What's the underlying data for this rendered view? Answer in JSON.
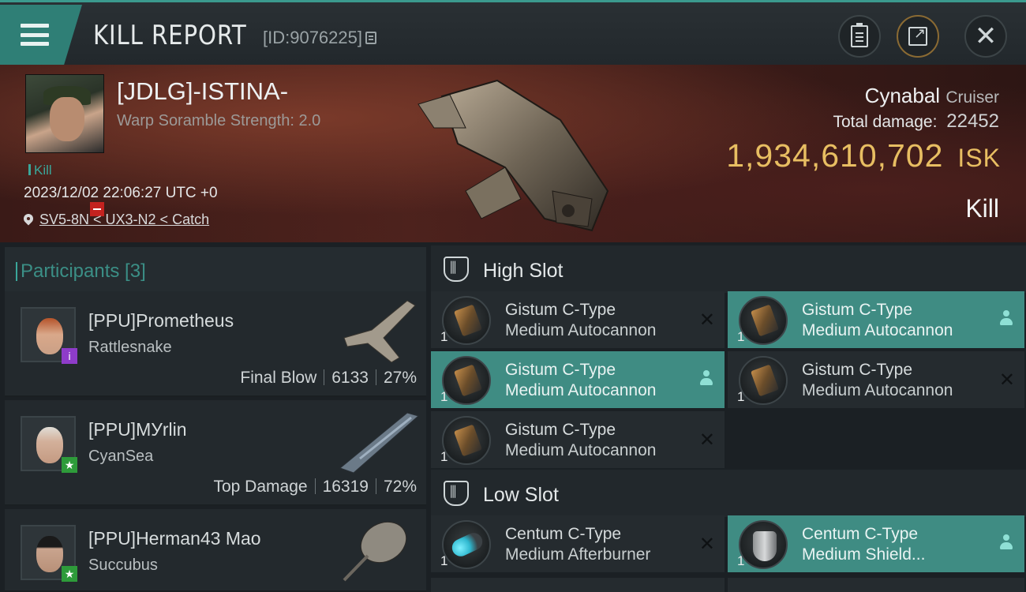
{
  "header": {
    "title": "KILL REPORT",
    "report_id": "[ID:9076225]"
  },
  "victim": {
    "pilot": "[JDLG]-ISTINA-",
    "subtitle": "Warp Soramble Strength: 2.0",
    "tag": "Kill",
    "timestamp": "2023/12/02 22:06:27 UTC +0",
    "location": "SV5-8N < UX3-N2 < Catch",
    "ship": "Cynabal",
    "ship_class": "Cruiser",
    "total_damage_label": "Total damage:",
    "total_damage": "22452",
    "isk_value": "1,934,610,702",
    "isk_unit": "ISK",
    "result": "Kill"
  },
  "participants": {
    "label": "Participants [3]",
    "items": [
      {
        "name": "[PPU]Prometheus",
        "ship": "Rattlesnake",
        "stat_label": "Final Blow",
        "damage": "6133",
        "percent": "27%",
        "badge": "i",
        "badge_color": "#8e3cc9"
      },
      {
        "name": "[PPU]MУrlin",
        "ship": "CyanSea",
        "stat_label": "Top Damage",
        "damage": "16319",
        "percent": "72%",
        "badge": "★",
        "badge_color": "#2e9b3a"
      },
      {
        "name": "[PPU]Herman43 Mao",
        "ship": "Succubus",
        "stat_label": "",
        "damage": "",
        "percent": "",
        "badge": "★",
        "badge_color": "#2e9b3a"
      }
    ]
  },
  "modules": {
    "high_slot_label": "High Slot",
    "low_slot_label": "Low Slot",
    "high": [
      {
        "qty": "1",
        "line1": "Gistum C-Type",
        "line2": "Medium Autocannon",
        "state": "destroyed"
      },
      {
        "qty": "1",
        "line1": "Gistum C-Type",
        "line2": "Medium Autocannon",
        "state": "dropped"
      },
      {
        "qty": "1",
        "line1": "Gistum C-Type",
        "line2": "Medium Autocannon",
        "state": "dropped"
      },
      {
        "qty": "1",
        "line1": "Gistum C-Type",
        "line2": "Medium Autocannon",
        "state": "destroyed"
      },
      {
        "qty": "1",
        "line1": "Gistum C-Type",
        "line2": "Medium Autocannon",
        "state": "destroyed"
      }
    ],
    "low": [
      {
        "qty": "1",
        "line1": "Centum C-Type",
        "line2": "Medium Afterburner",
        "state": "destroyed"
      },
      {
        "qty": "1",
        "line1": "Centum C-Type",
        "line2": "Medium Shield...",
        "state": "dropped"
      }
    ]
  },
  "icons": {
    "menu": "hamburger-icon",
    "copy": "copy-icon",
    "clipboard": "clipboard-icon",
    "share": "share-icon",
    "close": "close-icon",
    "location": "pin-icon",
    "slot": "slot-shield-icon",
    "destroyed": "x-icon",
    "dropped": "person-icon"
  },
  "colors": {
    "accent": "#3aa79a",
    "isk": "#e8be62",
    "active_row": "#3f8c83"
  }
}
